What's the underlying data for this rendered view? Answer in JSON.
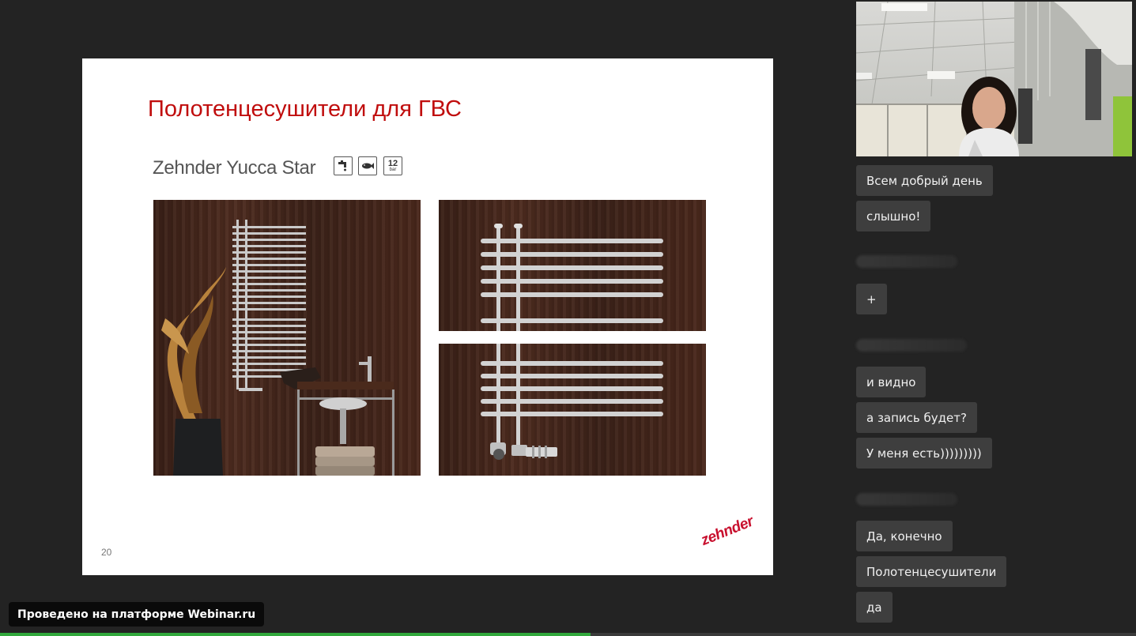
{
  "slide": {
    "title": "Полотенцесушители для ГВС",
    "product_name": "Zehnder Yucca Star",
    "feature_icons": [
      "faucet-icon",
      "fish-icon",
      "pressure-rating-icon"
    ],
    "pressure_value": "12",
    "pressure_unit": "bar",
    "page_number": "20",
    "logo_text": "zehnder"
  },
  "chat": {
    "messages": [
      {
        "kind": "message",
        "text": "Всем добрый день"
      },
      {
        "kind": "message",
        "text": "слышно!"
      },
      {
        "kind": "author"
      },
      {
        "kind": "message",
        "text": "+"
      },
      {
        "kind": "author"
      },
      {
        "kind": "message",
        "text": "и видно"
      },
      {
        "kind": "message",
        "text": "а запись будет?"
      },
      {
        "kind": "message",
        "text": "У меня есть)))))))))"
      },
      {
        "kind": "author"
      },
      {
        "kind": "message",
        "text": "Да, конечно"
      },
      {
        "kind": "message",
        "text": "Полотенцесушители"
      },
      {
        "kind": "message",
        "text": "да"
      }
    ]
  },
  "footer": {
    "platform_label": "Проведено на платформе Webinar.ru",
    "progress_fraction": 0.52
  },
  "colors": {
    "background": "#232323",
    "slide_title": "#c00d0d",
    "brand_red": "#c8102e",
    "chat_bubble": "#3e3e3e",
    "progress": "#31a83c"
  }
}
